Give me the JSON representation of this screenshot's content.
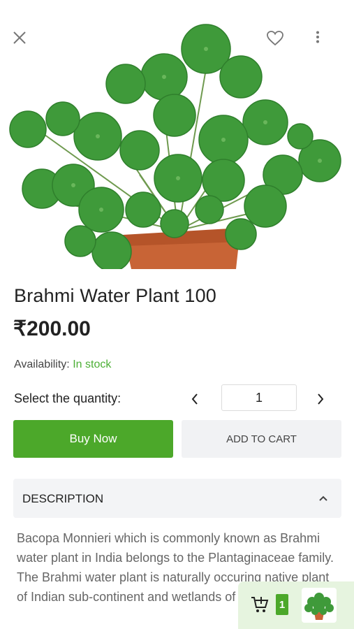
{
  "product": {
    "title": "Brahmi Water Plant 100",
    "price": "₹200.00",
    "availability_label": "Availability:",
    "availability_value": "In stock"
  },
  "quantity": {
    "label": "Select the quantity:",
    "value": "1"
  },
  "actions": {
    "buy_now": "Buy Now",
    "add_to_cart": "ADD TO CART"
  },
  "description": {
    "header": "DESCRIPTION",
    "text": "Bacopa Monnieri which is commonly known as Brahmi water plant in India belongs to the Plantaginaceae family. The Brahmi water plant is naturally occuring native plant of Indian sub-continent and wetlands of other countries."
  },
  "floating_cart": {
    "count": "1"
  },
  "icons": {
    "close": "close-icon",
    "favorite": "heart-icon",
    "more": "more-vertical-icon",
    "prev": "chevron-left-icon",
    "next": "chevron-right-icon",
    "collapse": "chevron-up-icon",
    "cart": "cart-add-icon"
  },
  "colors": {
    "accent": "#4ca82a",
    "stock": "#4caf35",
    "float_bg": "#e6f4df"
  }
}
